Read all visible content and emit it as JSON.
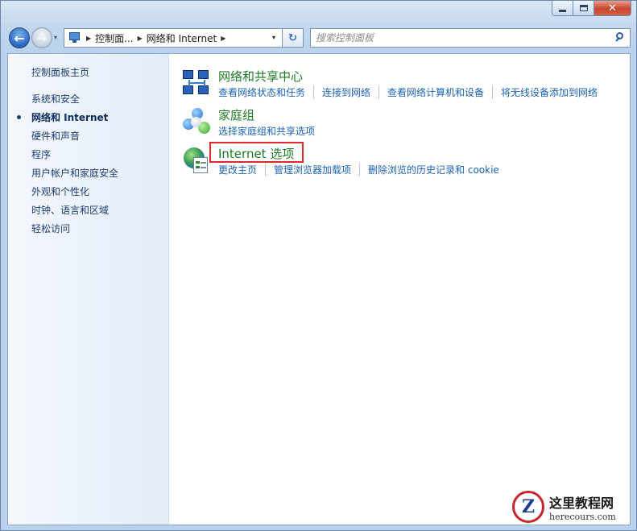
{
  "window": {
    "controls": {
      "minimize": "",
      "maximize": "",
      "close": "✕"
    }
  },
  "navbar": {
    "back_icon": "←",
    "forward_icon": "→",
    "recent_icon": "▾",
    "breadcrumb": [
      "控制面...",
      "网络和 Internet"
    ],
    "dropdown_icon": "▾",
    "refresh_icon": "↻",
    "search_placeholder": "搜索控制面板"
  },
  "sidebar": {
    "home": "控制面板主页",
    "items": [
      {
        "label": "系统和安全",
        "active": false
      },
      {
        "label": "网络和 Internet",
        "active": true
      },
      {
        "label": "硬件和声音",
        "active": false
      },
      {
        "label": "程序",
        "active": false
      },
      {
        "label": "用户帐户和家庭安全",
        "active": false
      },
      {
        "label": "外观和个性化",
        "active": false
      },
      {
        "label": "时钟、语言和区域",
        "active": false
      },
      {
        "label": "轻松访问",
        "active": false
      }
    ]
  },
  "main": {
    "categories": [
      {
        "title": "网络和共享中心",
        "icon": "network-icon",
        "links": [
          "查看网络状态和任务",
          "连接到网络",
          "查看网络计算机和设备",
          "将无线设备添加到网络"
        ]
      },
      {
        "title": "家庭组",
        "icon": "homegroup-icon",
        "links": [
          "选择家庭组和共享选项"
        ]
      },
      {
        "title": "Internet 选项",
        "icon": "internet-options-icon",
        "links": [
          "更改主页",
          "管理浏览器加载项",
          "删除浏览的历史记录和 cookie"
        ]
      }
    ]
  },
  "colors": {
    "category_title": "#1e7b24",
    "link": "#1b63b4",
    "highlight": "#e0292b"
  },
  "watermark": {
    "logo_letter": "Z",
    "title": "这里教程网",
    "subtitle": "herecours.com"
  }
}
